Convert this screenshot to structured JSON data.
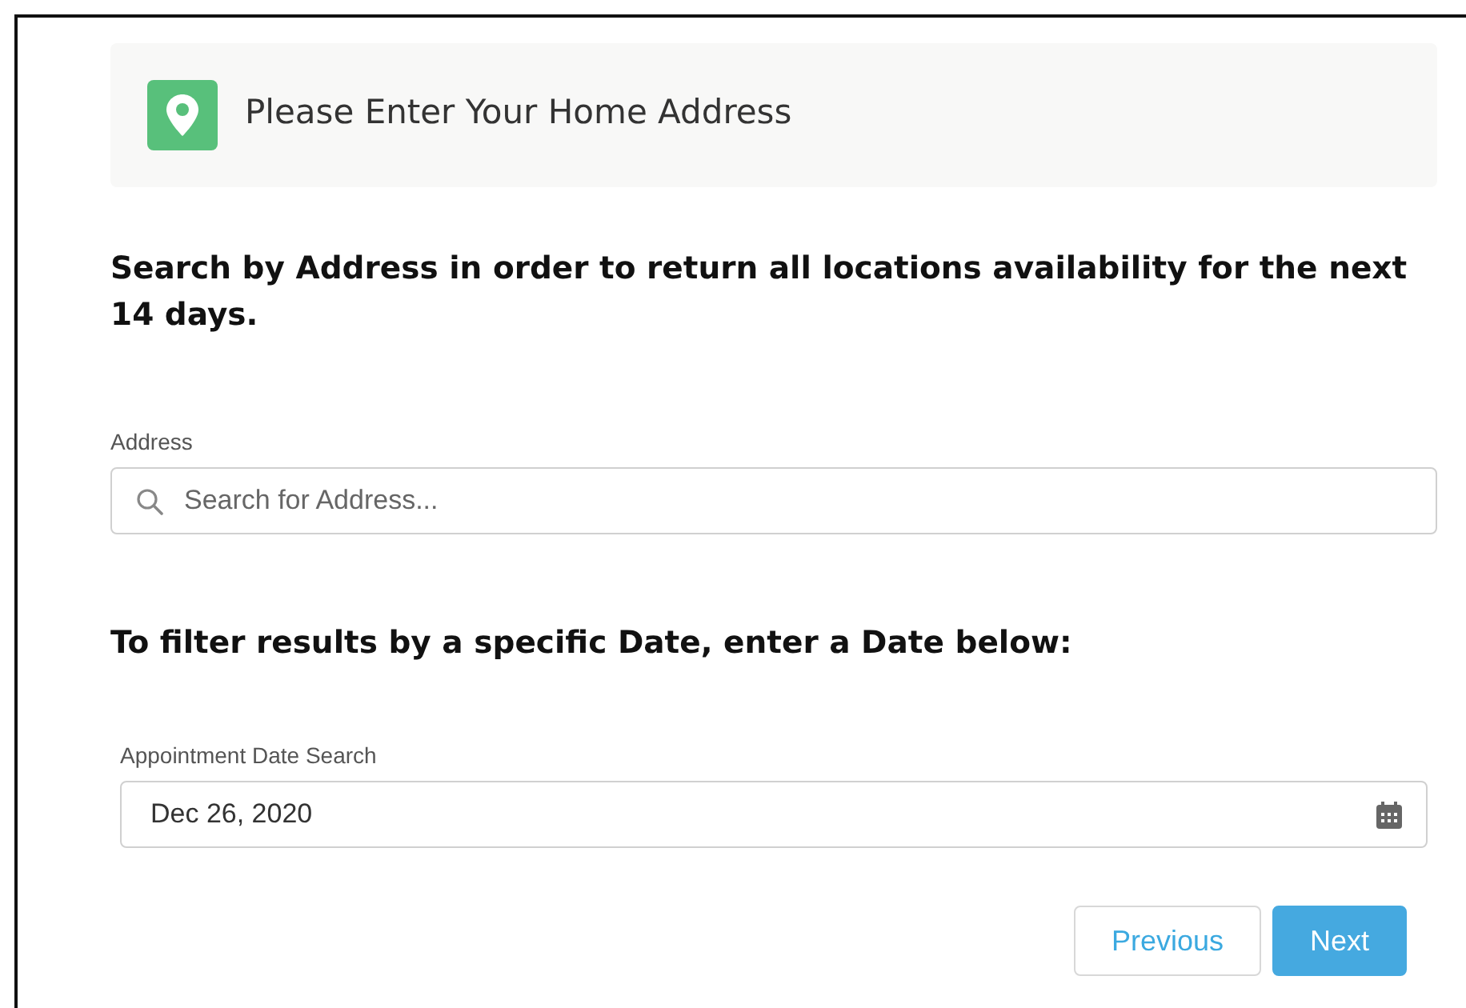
{
  "header": {
    "title": "Please Enter Your Home Address"
  },
  "intro": "Search by Address in order to return all locations availability for the next 14 days.",
  "address_field": {
    "label": "Address",
    "placeholder": "Search for Address..."
  },
  "filter_heading": "To filter results by a specific Date, enter a Date below:",
  "date_field": {
    "label": "Appointment Date Search",
    "value": "Dec 26, 2020"
  },
  "buttons": [
    {
      "label": "Previous",
      "kind": "secondary"
    },
    {
      "label": "Next",
      "kind": "primary"
    }
  ]
}
